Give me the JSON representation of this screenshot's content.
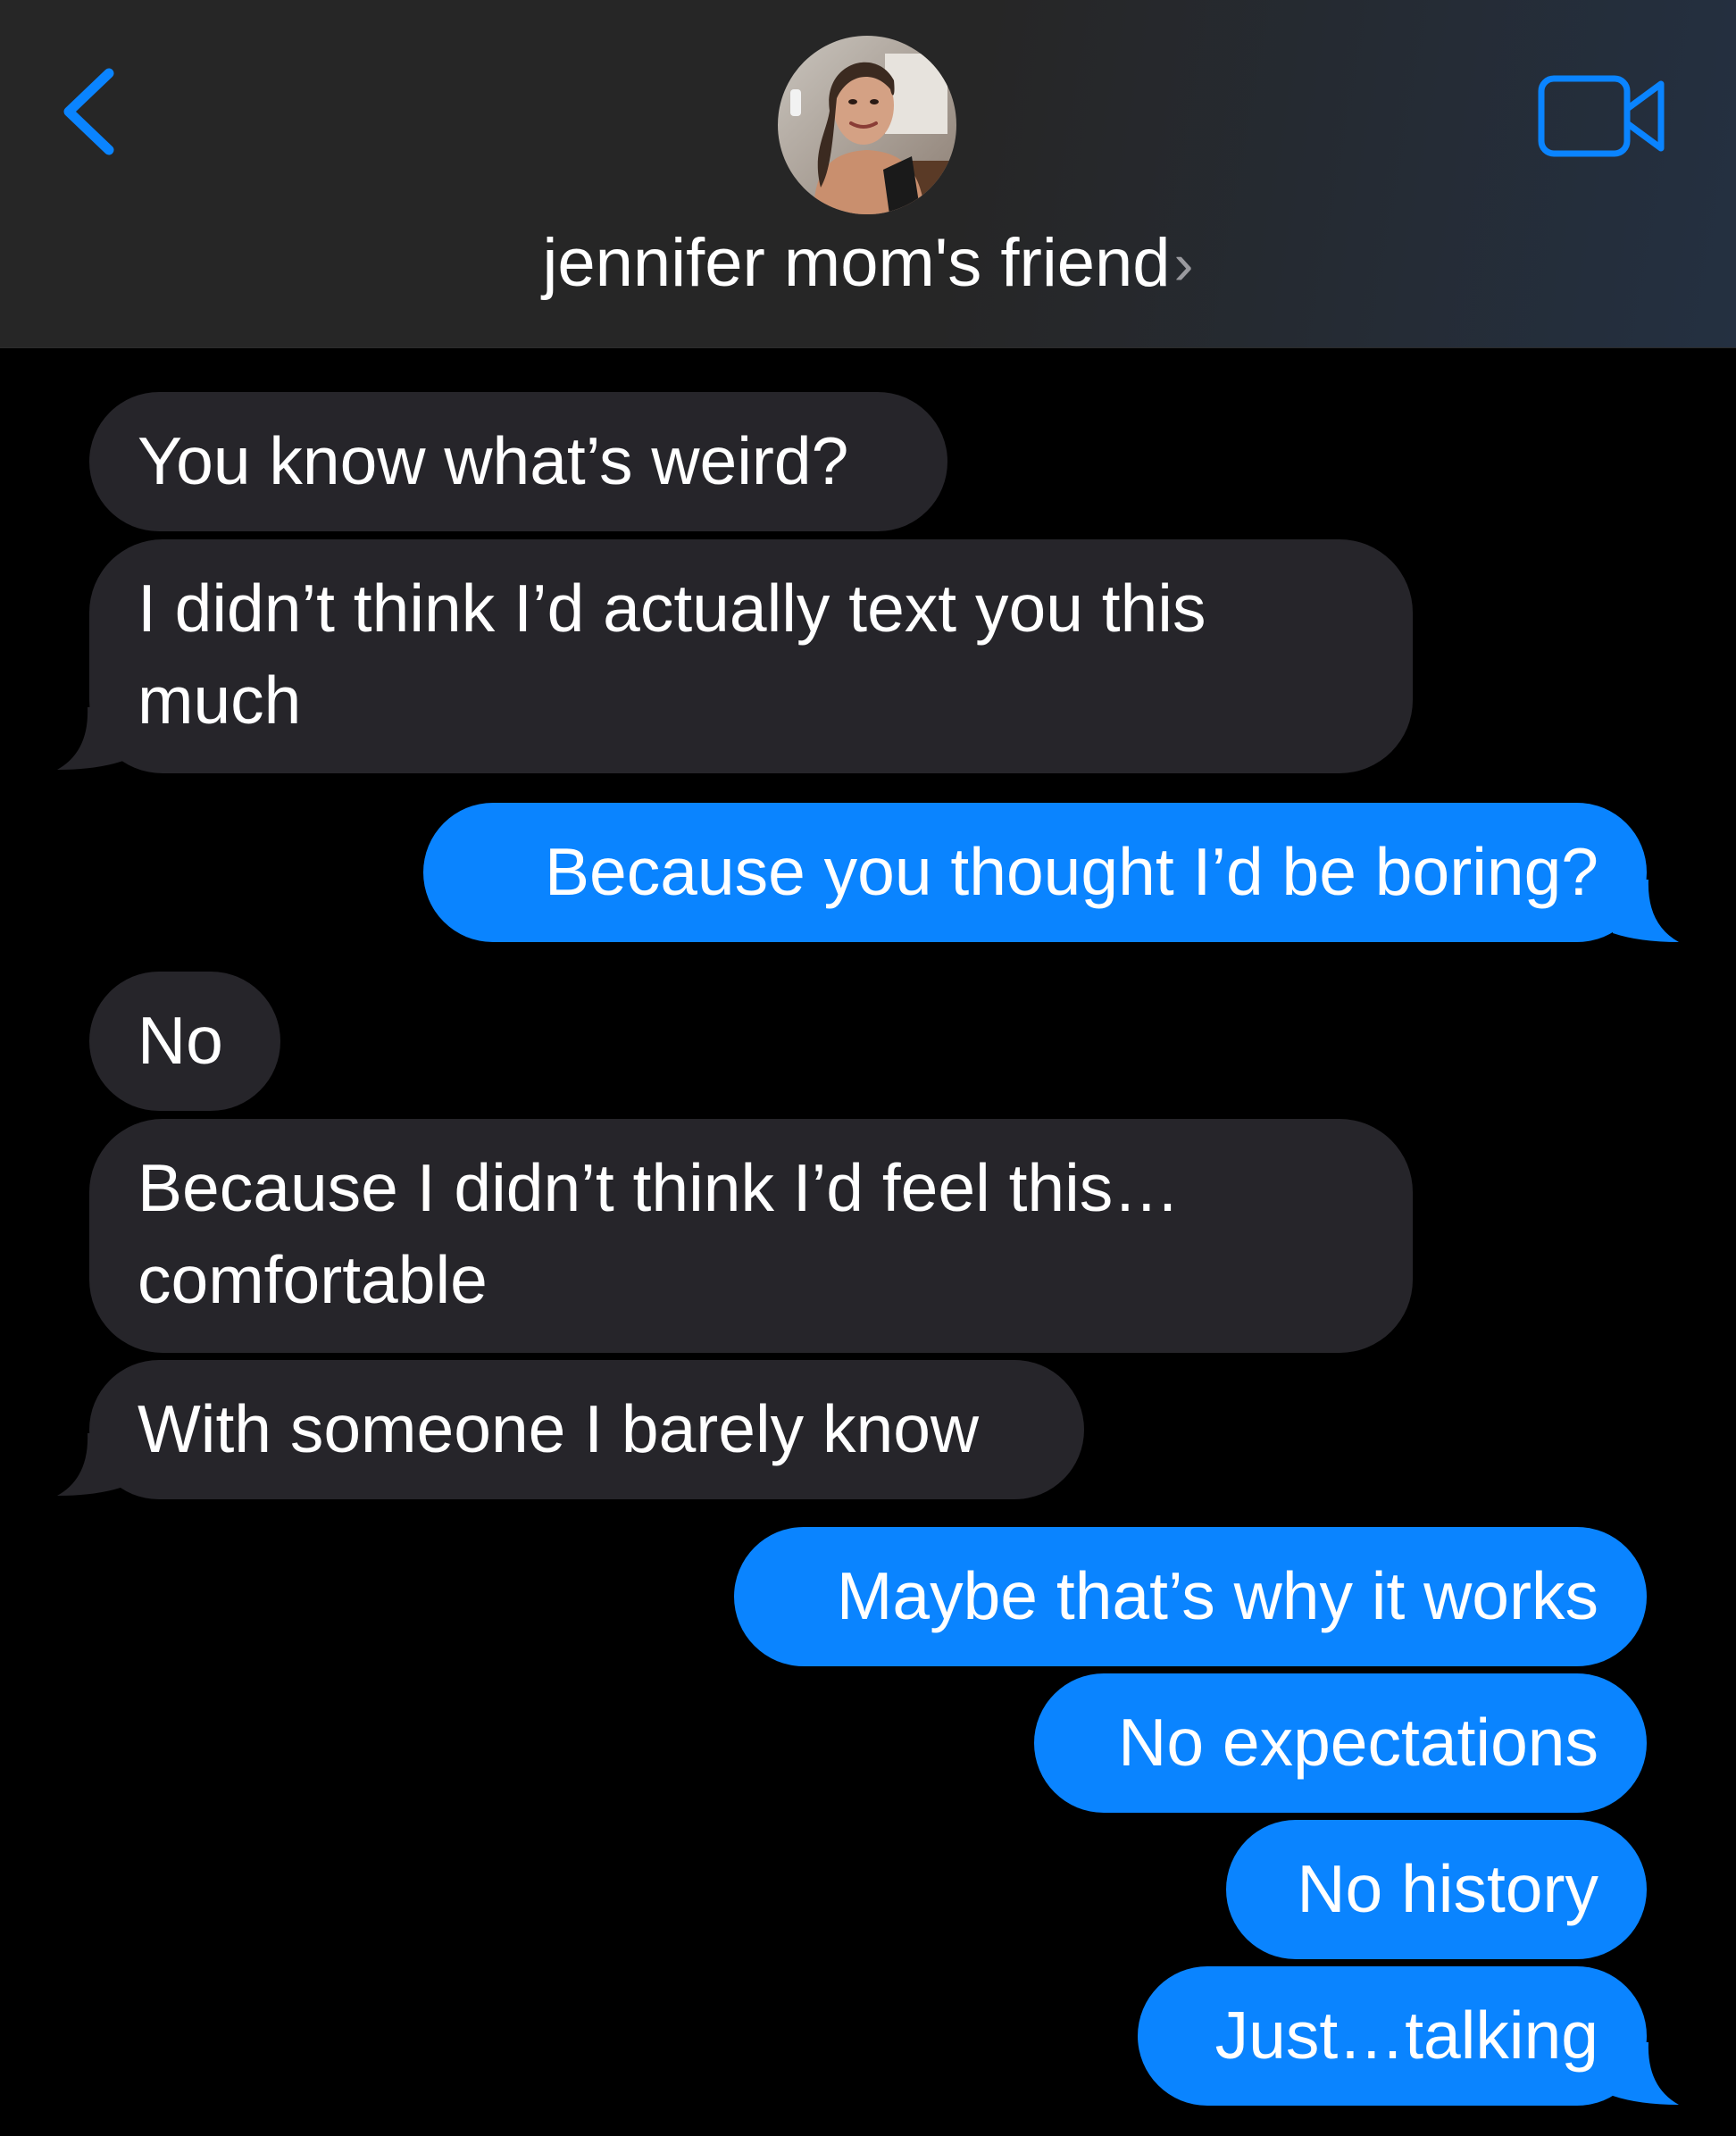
{
  "colors": {
    "accent": "#0a84ff",
    "incoming_bubble": "#26252a",
    "background": "#000000"
  },
  "header": {
    "back_icon": "chevron-left-icon",
    "contact_name": "jennifer mom's friend",
    "contact_chevron": "›",
    "video_icon": "video-camera-icon"
  },
  "messages": [
    {
      "direction": "incoming",
      "text": "You know what’s weird?"
    },
    {
      "direction": "incoming",
      "line1": "I didn’t think I’d actually text you this",
      "line2": "much"
    },
    {
      "direction": "outgoing",
      "text": "Because you thought I’d be boring?"
    },
    {
      "direction": "incoming",
      "text": "No"
    },
    {
      "direction": "incoming",
      "line1": "Because I didn’t think I’d feel this…",
      "line2": "comfortable"
    },
    {
      "direction": "incoming",
      "text": "With someone I barely know"
    },
    {
      "direction": "outgoing",
      "text": "Maybe that’s why it works"
    },
    {
      "direction": "outgoing",
      "text": "No expectations"
    },
    {
      "direction": "outgoing",
      "text": "No history"
    },
    {
      "direction": "outgoing",
      "text": "Just…talking"
    }
  ]
}
